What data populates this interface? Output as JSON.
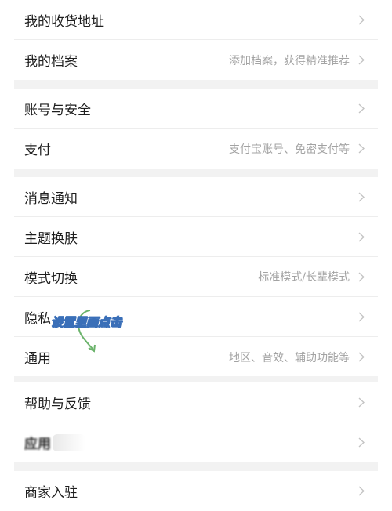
{
  "groups": [
    {
      "items": [
        {
          "label": "我的收货地址",
          "hint": ""
        },
        {
          "label": "我的档案",
          "hint": "添加档案，获得精准推荐"
        }
      ]
    },
    {
      "items": [
        {
          "label": "账号与安全",
          "hint": ""
        },
        {
          "label": "支付",
          "hint": "支付宝账号、免密支付等"
        }
      ]
    },
    {
      "items": [
        {
          "label": "消息通知",
          "hint": ""
        },
        {
          "label": "主题换肤",
          "hint": ""
        },
        {
          "label": "模式切换",
          "hint": "标准模式/长辈模式"
        },
        {
          "label": "隐私",
          "hint": ""
        },
        {
          "label": "通用",
          "hint": "地区、音效、辅助功能等"
        }
      ]
    },
    {
      "items": [
        {
          "label": "帮助与反馈",
          "hint": ""
        },
        {
          "label": "应用",
          "hint": ""
        }
      ]
    },
    {
      "items": [
        {
          "label": "商家入驻",
          "hint": ""
        }
      ]
    }
  ],
  "watermark": {
    "text": "设置里面点击"
  },
  "colors": {
    "separator": "#f2f2f2",
    "hint": "#a3a3a3",
    "chevron": "#c4c4c4",
    "watermark_outline": "#3a6fb8",
    "watermark_arrow": "#6bb36b"
  },
  "icons": {
    "chevron": "chevron-right-icon"
  }
}
